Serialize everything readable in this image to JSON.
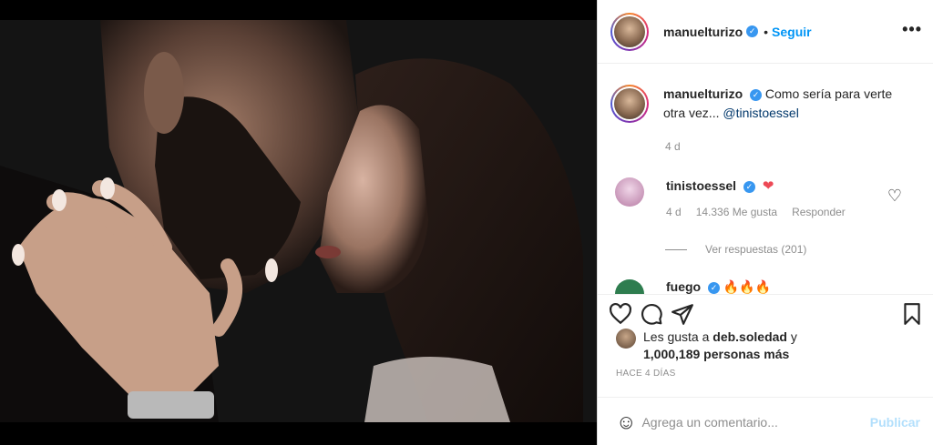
{
  "post": {
    "username": "manuelturizo",
    "follow_label": "Seguir",
    "dot": "•",
    "more_label": "•••",
    "caption_user": "manuelturizo",
    "caption_text": " Como sería para verte otra vez... ",
    "caption_mention": "@tinistoessel",
    "caption_time": "4 d"
  },
  "comments": [
    {
      "username": "tinistoessel",
      "text": "❤",
      "time": "4 d",
      "likes": "14.336 Me gusta",
      "reply_label": "Responder",
      "view_replies": "Ver respuestas (201)"
    },
    {
      "username": "fuego",
      "text": "🔥🔥🔥"
    }
  ],
  "footer": {
    "liked_by_prefix": "Les gusta a ",
    "liked_by_user": "deb.soledad",
    "liked_by_suffix": " y",
    "liked_by_count": "1,000,189 personas más",
    "time_ago": "HACE 4 DÍAS",
    "comment_placeholder": "Agrega un comentario...",
    "publish_label": "Publicar"
  },
  "colors": {
    "accent": "#0095f6",
    "verified": "#3897f0",
    "heart": "#ed4956",
    "muted": "#8e8e8e"
  }
}
